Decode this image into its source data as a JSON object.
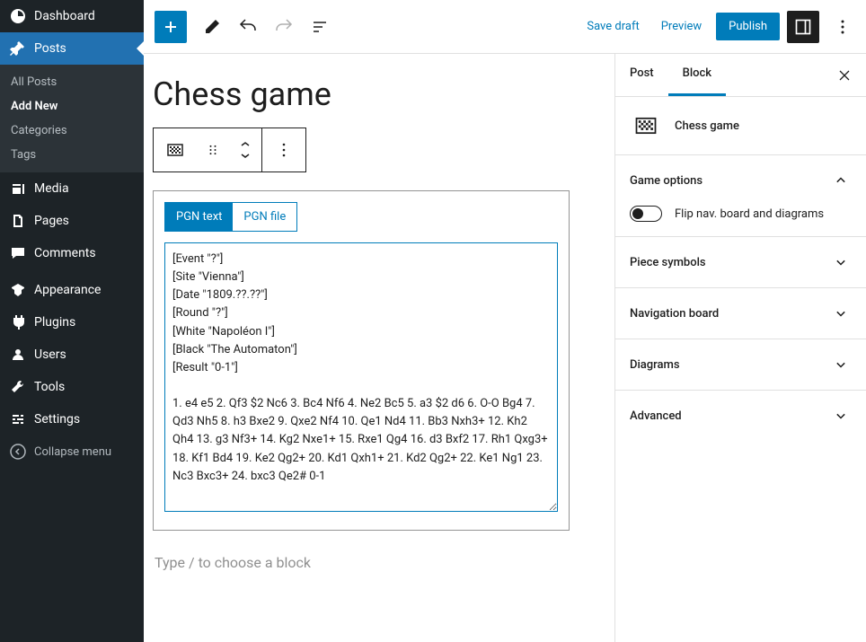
{
  "sidebar": {
    "items": [
      {
        "label": "Dashboard"
      },
      {
        "label": "Posts"
      },
      {
        "label": "Media"
      },
      {
        "label": "Pages"
      },
      {
        "label": "Comments"
      },
      {
        "label": "Appearance"
      },
      {
        "label": "Plugins"
      },
      {
        "label": "Users"
      },
      {
        "label": "Tools"
      },
      {
        "label": "Settings"
      }
    ],
    "submenu": [
      {
        "label": "All Posts"
      },
      {
        "label": "Add New"
      },
      {
        "label": "Categories"
      },
      {
        "label": "Tags"
      }
    ],
    "collapse_label": "Collapse menu"
  },
  "topbar": {
    "save_draft": "Save draft",
    "preview": "Preview",
    "publish": "Publish"
  },
  "post": {
    "title": "Chess game",
    "placeholder_line": "Type / to choose a block"
  },
  "chess_block": {
    "tabs": {
      "pgn_text": "PGN text",
      "pgn_file": "PGN file"
    },
    "pgn": "[Event \"?\"]\n[Site \"Vienna\"]\n[Date \"1809.??.??\"]\n[Round \"?\"]\n[White \"Napoléon I\"]\n[Black \"The Automaton\"]\n[Result \"0-1\"]\n\n1. e4 e5 2. Qf3 $2 Nc6 3. Bc4 Nf6 4. Ne2 Bc5 5. a3 $2 d6 6. O-O Bg4 7. Qd3 Nh5 8. h3 Bxe2 9. Qxe2 Nf4 10. Qe1 Nd4 11. Bb3 Nxh3+ 12. Kh2 Qh4 13. g3 Nf3+ 14. Kg2 Nxe1+ 15. Rxe1 Qg4 16. d3 Bxf2 17. Rh1 Qxg3+ 18. Kf1 Bd4 19. Ke2 Qg2+ 20. Kd1 Qxh1+ 21. Kd2 Qg2+ 22. Ke1 Ng1 23. Nc3 Bxc3+ 24. bxc3 Qe2# 0-1"
  },
  "settings": {
    "tabs": {
      "post": "Post",
      "block": "Block"
    },
    "block_name": "Chess game",
    "sections": {
      "game_options": "Game options",
      "flip_label": "Flip nav. board and diagrams",
      "piece_symbols": "Piece symbols",
      "navigation_board": "Navigation board",
      "diagrams": "Diagrams",
      "advanced": "Advanced"
    }
  }
}
